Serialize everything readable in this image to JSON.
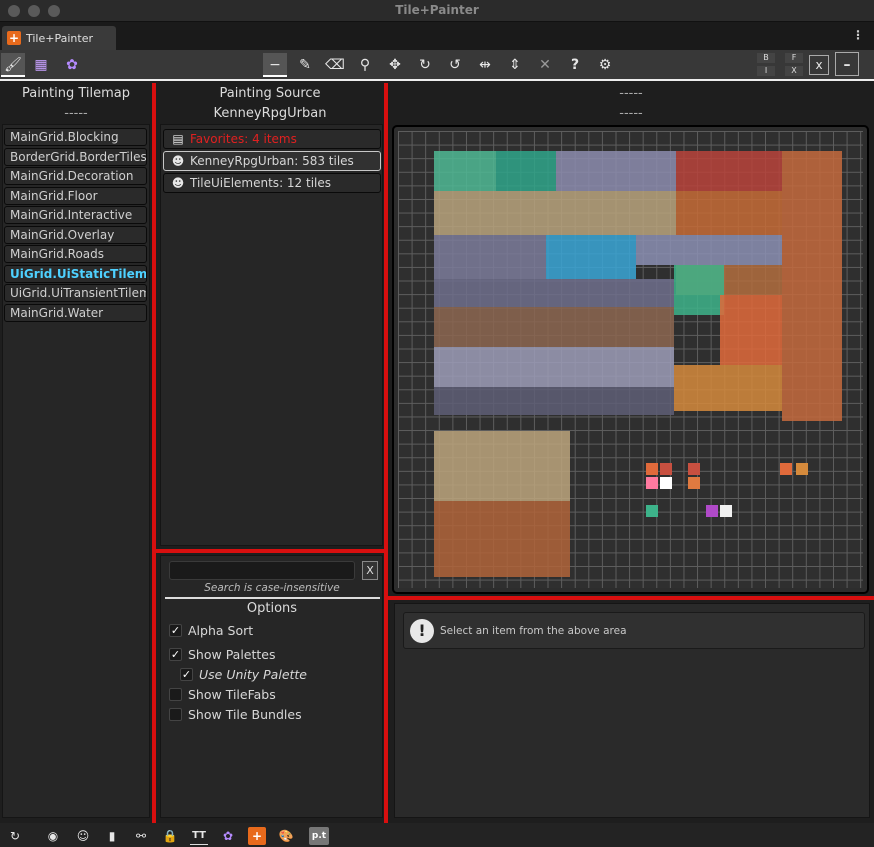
{
  "window": {
    "title": "Tile+Painter"
  },
  "tab": {
    "label": "Tile+Painter",
    "icon": "plus-icon"
  },
  "toolbar": {
    "left_tools": [
      "paint-brush-icon",
      "grid-icon",
      "palette-cluster-icon"
    ],
    "center_tools": [
      "minus-icon",
      "paint-icon",
      "eraser-icon",
      "eyedropper-icon",
      "move-icon",
      "rotate-cw-icon",
      "rotate-ccw-icon",
      "flip-x-icon",
      "flip-y-icon",
      "close-icon",
      "help-icon",
      "gear-icon"
    ],
    "help_label": "?",
    "mini_buttons": [
      "B",
      "I",
      "F",
      "X"
    ],
    "clear_label": "x",
    "minimize_label": "–"
  },
  "tilemap_panel": {
    "title": "Painting Tilemap",
    "subtitle": "-----",
    "items": [
      {
        "label": "MainGrid.Blocking",
        "active": false
      },
      {
        "label": "BorderGrid.BorderTiles",
        "active": false
      },
      {
        "label": "MainGrid.Decoration",
        "active": false
      },
      {
        "label": "MainGrid.Floor",
        "active": false
      },
      {
        "label": "MainGrid.Interactive",
        "active": false
      },
      {
        "label": "MainGrid.Overlay",
        "active": false
      },
      {
        "label": "MainGrid.Roads",
        "active": false
      },
      {
        "label": "UiGrid.UiStaticTilemap",
        "active": true
      },
      {
        "label": "UiGrid.UiTransientTilemap",
        "active": false
      },
      {
        "label": "MainGrid.Water",
        "active": false
      }
    ]
  },
  "source_panel": {
    "title": "Painting Source",
    "subtitle": "KenneyRpgUrban",
    "items": [
      {
        "label": "Favorites: 4 items",
        "icon": "clipboard-icon",
        "color": "#e02020"
      },
      {
        "label": "KenneyRpgUrban: 583 tiles",
        "icon": "palette-icon",
        "color": "#d6d6d6"
      },
      {
        "label": "TileUiElements: 12 tiles",
        "icon": "palette-icon",
        "color": "#d6d6d6"
      }
    ]
  },
  "search": {
    "value": "",
    "placeholder": "",
    "clear_label": "X",
    "hint": "Search is case-insensitive"
  },
  "options": {
    "title": "Options",
    "items": [
      {
        "label": "Alpha Sort",
        "checked": true,
        "indent": false,
        "italic": false
      },
      {
        "label": "Show Palettes",
        "checked": true,
        "indent": false,
        "italic": false
      },
      {
        "label": "Use Unity Palette",
        "checked": true,
        "indent": true,
        "italic": true
      },
      {
        "label": "Show TileFabs",
        "checked": false,
        "indent": false,
        "italic": false
      },
      {
        "label": "Show Tile Bundles",
        "checked": false,
        "indent": false,
        "italic": false
      }
    ]
  },
  "preview_panel": {
    "title": "-----",
    "subtitle": "-----"
  },
  "info": {
    "icon": "info-icon",
    "message": "Select an item from the above area"
  },
  "statusbar": {
    "icons": [
      "refresh-icon",
      "eye-icon",
      "face-icon",
      "trash-icon",
      "link-icon",
      "lock-icon",
      "text-icon",
      "palette-cluster-icon",
      "plus-icon",
      "palette-icon",
      "pt-icon"
    ],
    "pt_label": "p.t",
    "tt_label": "TT"
  },
  "colors": {
    "accent_red": "#d80f0f",
    "active_item": "#4ed1ff",
    "favorites": "#e02020",
    "brand_orange": "#e86a1c"
  }
}
